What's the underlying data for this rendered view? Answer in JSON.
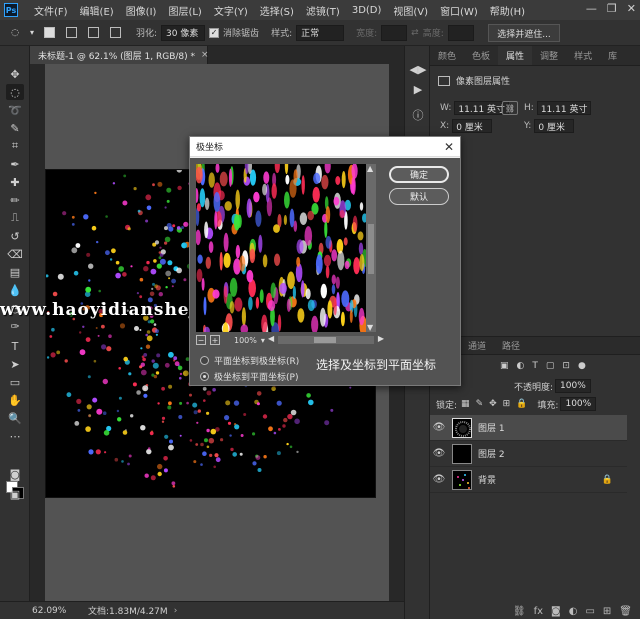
{
  "app": {
    "logo": "Ps"
  },
  "menu": [
    "文件(F)",
    "编辑(E)",
    "图像(I)",
    "图层(L)",
    "文字(Y)",
    "选择(S)",
    "滤镜(T)",
    "3D(D)",
    "视图(V)",
    "窗口(W)",
    "帮助(H)"
  ],
  "window_controls": {
    "minimize": "—",
    "restore": "❐",
    "close": "✕"
  },
  "options_bar": {
    "feather_label": "羽化:",
    "feather_value": "30 像素",
    "antialias_label": "消除锯齿",
    "style_label": "样式:",
    "style_value": "正常",
    "width_label": "宽度:",
    "height_label": "高度:",
    "select_mask_button": "选择并遮住..."
  },
  "document": {
    "tab_title": "未标题-1 @ 62.1% (图层 1, RGB/8) *",
    "close": "×"
  },
  "status": {
    "zoom": "62.09%",
    "info": "文档:1.83M/4.27M",
    "arrow": "›"
  },
  "watermark": "www.haoyidiansheji.com",
  "properties_panel": {
    "tabs": [
      "颜色",
      "色板",
      "属性",
      "调整",
      "样式",
      "库"
    ],
    "active_tab": "属性",
    "title": "像素图层属性",
    "w_label": "W:",
    "w_value": "11.11 英寸",
    "h_label": "H:",
    "h_value": "11.11 英寸",
    "x_label": "X:",
    "x_value": "0 厘米",
    "y_label": "Y:",
    "y_value": "0 厘米"
  },
  "layers_panel": {
    "tabs": [
      "通道",
      "路径"
    ],
    "opacity_label": "不透明度:",
    "opacity_value": "100%",
    "lock_label": "锁定:",
    "fill_label": "填充:",
    "fill_value": "100%",
    "layers": [
      {
        "name": "图层 1",
        "selected": true
      },
      {
        "name": "图层 2",
        "selected": false
      },
      {
        "name": "背景",
        "selected": false,
        "locked": true
      }
    ]
  },
  "dialog": {
    "title": "极坐标",
    "close": "✕",
    "ok_button": "确定",
    "default_button": "默认",
    "zoom_value": "100%",
    "option_rect_to_polar": "平面坐标到极坐标(R)",
    "option_polar_to_rect": "极坐标到平面坐标(P)",
    "selected_option": "polar_to_rect",
    "annotation": "选择及坐标到平面坐标"
  },
  "icons": {
    "eye": "eye-icon",
    "lock": "lock-icon",
    "link": "link-icon",
    "move": "move-icon",
    "marquee": "marquee-icon",
    "lasso": "lasso-icon"
  },
  "colors": {
    "accent_blue": "#2fa3ff",
    "canvas_black": "#000000",
    "panel_dark": "#323232"
  }
}
